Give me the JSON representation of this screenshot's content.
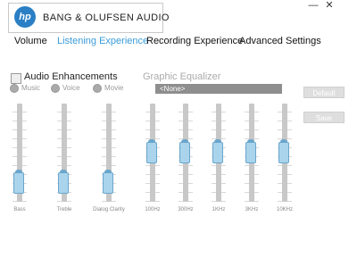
{
  "app": {
    "brand": "BANG & OLUFSEN AUDIO",
    "logo": "hp",
    "minimize_label": "—",
    "close_label": "✕"
  },
  "nav": {
    "tabs": [
      {
        "label": "Volume",
        "active": false
      },
      {
        "label": "Listening Experience",
        "active": true
      },
      {
        "label": "Recording Experience",
        "active": false
      },
      {
        "label": "Advanced Settings",
        "active": false
      }
    ]
  },
  "enhancements": {
    "title": "Audio Enhancements",
    "checked": false,
    "modes": [
      "Music",
      "Voice",
      "Movie"
    ],
    "sliders": [
      {
        "label": "Bass",
        "level": 0.1
      },
      {
        "label": "Treble",
        "level": 0.1
      },
      {
        "label": "Dialog Clarity",
        "level": 0.1
      }
    ]
  },
  "equalizer": {
    "title": "Graphic Equalizer",
    "preset": "<None>",
    "bands": [
      {
        "label": "100Hz",
        "level": 0.5
      },
      {
        "label": "300Hz",
        "level": 0.5
      },
      {
        "label": "1KHz",
        "level": 0.5
      },
      {
        "label": "3KHz",
        "level": 0.5
      },
      {
        "label": "10KHz",
        "level": 0.5
      }
    ]
  },
  "buttons": {
    "default_label": "Default",
    "save_label": "Save"
  },
  "colors": {
    "accent": "#3a9bd8",
    "thumb_fill": "#a9d4ec",
    "thumb_border": "#6aa6cc",
    "track": "#c8c8c8"
  }
}
